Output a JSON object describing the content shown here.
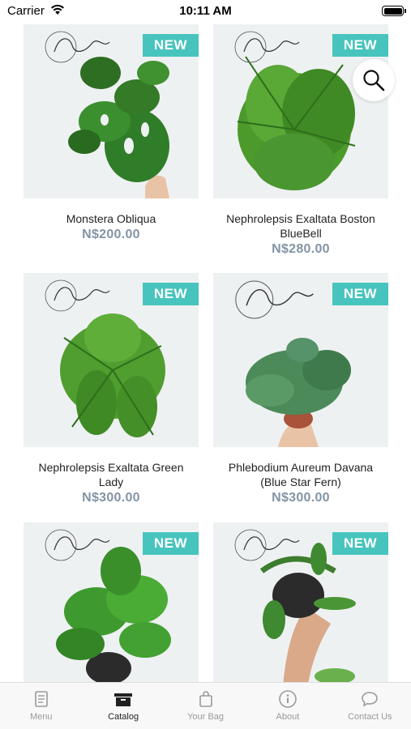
{
  "status": {
    "carrier": "Carrier",
    "time": "10:11 AM"
  },
  "catalog": {
    "badge": "NEW",
    "products": [
      {
        "name": "Monstera Obliqua",
        "price": "N$200.00"
      },
      {
        "name": "Nephrolepsis Exaltata Boston BlueBell",
        "price": "N$280.00"
      },
      {
        "name": "Nephrolepsis Exaltata Green Lady",
        "price": "N$300.00"
      },
      {
        "name": "Phlebodium Aureum Davana (Blue Star Fern)",
        "price": "N$300.00"
      },
      {
        "name": "",
        "price": ""
      },
      {
        "name": "",
        "price": ""
      }
    ]
  },
  "tabs": [
    {
      "label": "Menu",
      "icon": "menu-book-icon"
    },
    {
      "label": "Catalog",
      "icon": "catalog-box-icon",
      "active": true
    },
    {
      "label": "Your Bag",
      "icon": "shopping-bag-icon"
    },
    {
      "label": "About",
      "icon": "info-icon"
    },
    {
      "label": "Contact Us",
      "icon": "chat-bubble-icon"
    }
  ],
  "colors": {
    "badge": "#47c4bd",
    "price": "#8394a6",
    "tab_inactive": "#9a9a9a",
    "tab_active": "#222222"
  }
}
